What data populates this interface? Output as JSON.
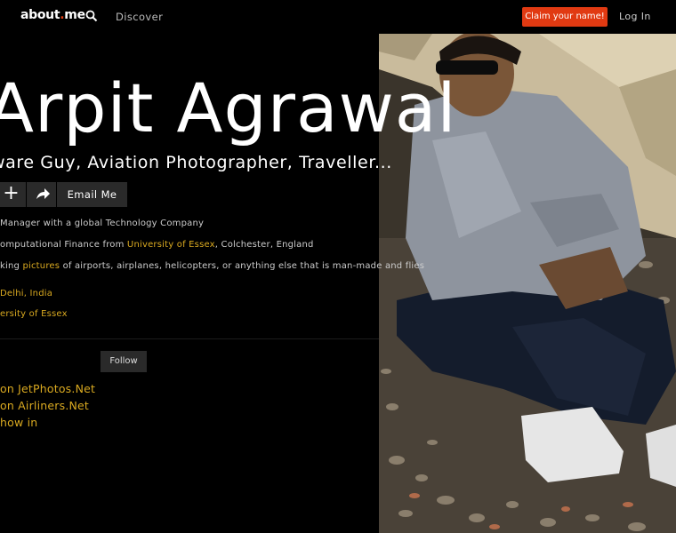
{
  "nav": {
    "logo_text": "about",
    "logo_dot": ".",
    "logo_suffix": "me",
    "discover": "Discover",
    "claim": "Claim your name!",
    "login": "Log In"
  },
  "profile": {
    "name": "Arpit Agrawal",
    "headline": "ware Guy, Aviation Photographer, Traveller...",
    "email_button": "Email Me",
    "bio": [
      {
        "pre": "Manager with a global Technology Company",
        "link": "",
        "post": ""
      },
      {
        "pre": "omputational Finance from ",
        "link": "University of Essex",
        "post": ", Colchester, England"
      },
      {
        "pre": "king ",
        "link": "pictures",
        "post": " of airports, airplanes, helicopters, or anything else that is man-made and flies"
      }
    ],
    "location": "Delhi, India",
    "education": "ersity of Essex"
  },
  "follow": {
    "label": "Follow"
  },
  "links": [
    "on JetPhotos.Net",
    "on Airliners.Net",
    "how in"
  ],
  "colors": {
    "accent": "#e13a12",
    "link": "#d9a920"
  }
}
